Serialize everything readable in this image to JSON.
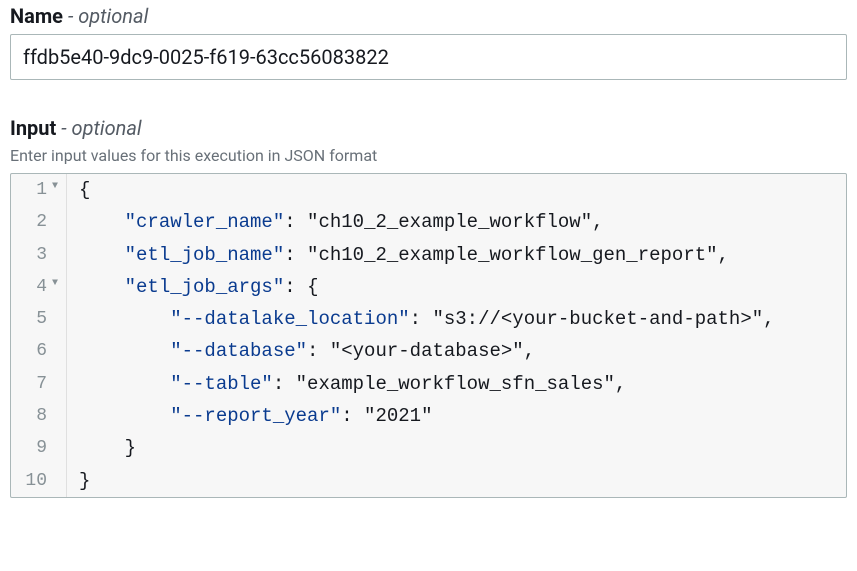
{
  "nameField": {
    "label": "Name",
    "optional": "optional",
    "value": "ffdb5e40-9dc9-0025-f619-63cc56083822"
  },
  "inputField": {
    "label": "Input",
    "optional": "optional",
    "hint": "Enter input values for this execution in JSON format"
  },
  "code": {
    "lines": [
      {
        "num": "1",
        "fold": true,
        "text": "{"
      },
      {
        "num": "2",
        "fold": false,
        "text": "    \"crawler_name\": \"ch10_2_example_workflow\","
      },
      {
        "num": "3",
        "fold": false,
        "text": "    \"etl_job_name\": \"ch10_2_example_workflow_gen_report\","
      },
      {
        "num": "4",
        "fold": true,
        "text": "    \"etl_job_args\": {"
      },
      {
        "num": "5",
        "fold": false,
        "text": "        \"--datalake_location\": \"s3://<your-bucket-and-path>\","
      },
      {
        "num": "6",
        "fold": false,
        "text": "        \"--database\": \"<your-database>\","
      },
      {
        "num": "7",
        "fold": false,
        "text": "        \"--table\": \"example_workflow_sfn_sales\","
      },
      {
        "num": "8",
        "fold": false,
        "text": "        \"--report_year\": \"2021\""
      },
      {
        "num": "9",
        "fold": false,
        "text": "    }"
      },
      {
        "num": "10",
        "fold": false,
        "text": "}"
      }
    ]
  },
  "parsed_input": {
    "crawler_name": "ch10_2_example_workflow",
    "etl_job_name": "ch10_2_example_workflow_gen_report",
    "etl_job_args": {
      "--datalake_location": "s3://<your-bucket-and-path>",
      "--database": "<your-database>",
      "--table": "example_workflow_sfn_sales",
      "--report_year": "2021"
    }
  }
}
